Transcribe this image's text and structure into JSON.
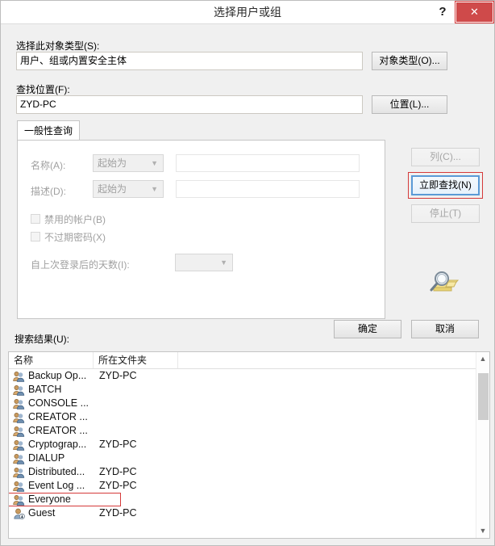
{
  "window": {
    "title": "选择用户或组",
    "help_label": "?",
    "close_label": "✕"
  },
  "object_type": {
    "label": "选择此对象类型(S):",
    "value": "用户、组或内置安全主体",
    "button": "对象类型(O)..."
  },
  "location": {
    "label": "查找位置(F):",
    "value": "ZYD-PC",
    "button": "位置(L)..."
  },
  "tabs": [
    {
      "label": "一般性查询",
      "active": true
    }
  ],
  "query": {
    "name_label": "名称(A):",
    "name_condition": "起始为",
    "name_value": "",
    "desc_label": "描述(D):",
    "desc_condition": "起始为",
    "desc_value": "",
    "disabled_accounts_label": "禁用的帐户(B)",
    "disabled_accounts_checked": false,
    "nonexpiring_password_label": "不过期密码(X)",
    "nonexpiring_password_checked": false,
    "days_since_logon_label": "自上次登录后的天数(I):",
    "days_since_logon_value": ""
  },
  "side_buttons": {
    "columns": "列(C)...",
    "find_now": "立即查找(N)",
    "stop": "停止(T)",
    "find_icon": "magnifier-folder-icon"
  },
  "dialog_buttons": {
    "ok": "确定",
    "cancel": "取消"
  },
  "results": {
    "label": "搜索结果(U):",
    "columns": [
      "名称",
      "所在文件夹",
      ""
    ],
    "rows": [
      {
        "name": "Backup Op...",
        "folder": "ZYD-PC",
        "icon": "group-icon"
      },
      {
        "name": "BATCH",
        "folder": "",
        "icon": "group-icon"
      },
      {
        "name": "CONSOLE ...",
        "folder": "",
        "icon": "group-icon"
      },
      {
        "name": "CREATOR ...",
        "folder": "",
        "icon": "group-icon"
      },
      {
        "name": "CREATOR ...",
        "folder": "",
        "icon": "group-icon"
      },
      {
        "name": "Cryptograp...",
        "folder": "ZYD-PC",
        "icon": "group-icon"
      },
      {
        "name": "DIALUP",
        "folder": "",
        "icon": "group-icon"
      },
      {
        "name": "Distributed...",
        "folder": "ZYD-PC",
        "icon": "group-icon"
      },
      {
        "name": "Event Log ...",
        "folder": "ZYD-PC",
        "icon": "group-icon"
      },
      {
        "name": "Everyone",
        "folder": "",
        "icon": "group-icon",
        "highlight": true
      },
      {
        "name": "Guest",
        "folder": "ZYD-PC",
        "icon": "user-icon"
      }
    ]
  },
  "colors": {
    "highlight_red": "#d53a3a",
    "close_red": "#cf4a4a",
    "focus_blue": "#5b9ad6"
  }
}
